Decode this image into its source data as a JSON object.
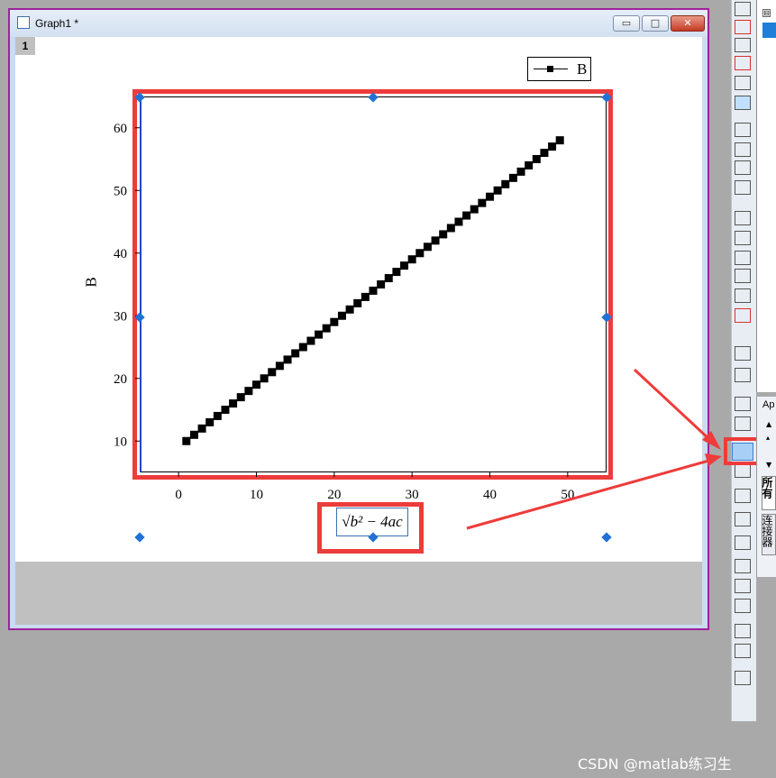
{
  "window": {
    "title": "Graph1 *",
    "layer_tag": "1",
    "min_glyph": "▭",
    "max_glyph": "□",
    "close_glyph": "✕"
  },
  "legend": {
    "label": "B"
  },
  "formula": {
    "text": "√b² − 4ac"
  },
  "side_panel": {
    "apps_label": "Ap",
    "collapse_glyph": "⊟",
    "tab_1": "所有",
    "tab_2": "连接器"
  },
  "watermark": "CSDN @matlab练习生",
  "chart_data": {
    "type": "scatter",
    "ylabel": "B",
    "xlim": [
      -5,
      55
    ],
    "ylim": [
      5,
      65
    ],
    "xticks": [
      0,
      10,
      20,
      30,
      40,
      50
    ],
    "yticks": [
      10,
      20,
      30,
      40,
      50,
      60
    ],
    "series": [
      {
        "name": "B",
        "marker": "square",
        "color": "#000000",
        "x": [
          1,
          2,
          3,
          4,
          5,
          6,
          7,
          8,
          9,
          10,
          11,
          12,
          13,
          14,
          15,
          16,
          17,
          18,
          19,
          20,
          21,
          22,
          23,
          24,
          25,
          26,
          27,
          28,
          29,
          30,
          31,
          32,
          33,
          34,
          35,
          36,
          37,
          38,
          39,
          40,
          41,
          42,
          43,
          44,
          45,
          46,
          47,
          48,
          49
        ],
        "y": [
          10,
          11,
          12,
          13,
          14,
          15,
          16,
          17,
          18,
          19,
          20,
          21,
          22,
          23,
          24,
          25,
          26,
          27,
          28,
          29,
          30,
          31,
          32,
          33,
          34,
          35,
          36,
          37,
          38,
          39,
          40,
          41,
          42,
          43,
          44,
          45,
          46,
          47,
          48,
          49,
          50,
          51,
          52,
          53,
          54,
          55,
          56,
          57,
          58
        ]
      }
    ]
  }
}
